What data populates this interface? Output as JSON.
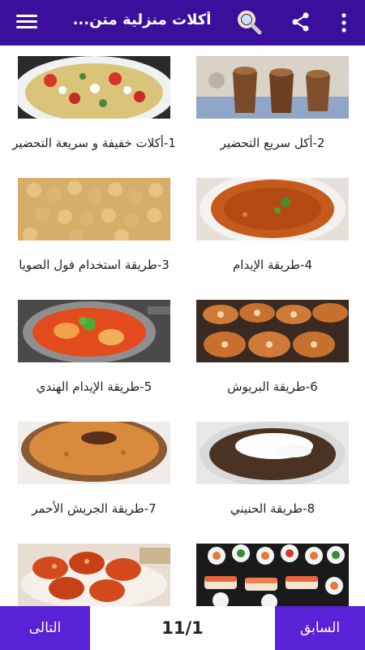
{
  "header": {
    "title": "أكلات منزلية متن...",
    "icons": [
      "menu-icon",
      "search-icon",
      "share-icon",
      "more-vert-icon"
    ],
    "background": "#3a0f9c"
  },
  "recipes": [
    {
      "label": "1-أكلات خفيفة و سريعة التحضير",
      "image": "pasta-salad"
    },
    {
      "label": "2-أكل سريع التحضير",
      "image": "chocolate-mousse"
    },
    {
      "label": "3-طريقة استخدام فول الصويا",
      "image": "soybeans"
    },
    {
      "label": "4-طريقة الإيدام",
      "image": "stew"
    },
    {
      "label": "5-طريقة الإيدام الهندي",
      "image": "indian-curry"
    },
    {
      "label": "6-طريقة البريوش",
      "image": "brioche"
    },
    {
      "label": "7-طريقة الجريش الأحمر",
      "image": "red-jareesh"
    },
    {
      "label": "8-طريقة الحنيني",
      "image": "hunaini"
    },
    {
      "label": "",
      "image": "fried-chicken"
    },
    {
      "label": "",
      "image": "sushi"
    }
  ],
  "footer": {
    "next_label": "التالى",
    "prev_label": "السابق",
    "page_indicator": "11/1",
    "button_color": "#5a22d6"
  }
}
